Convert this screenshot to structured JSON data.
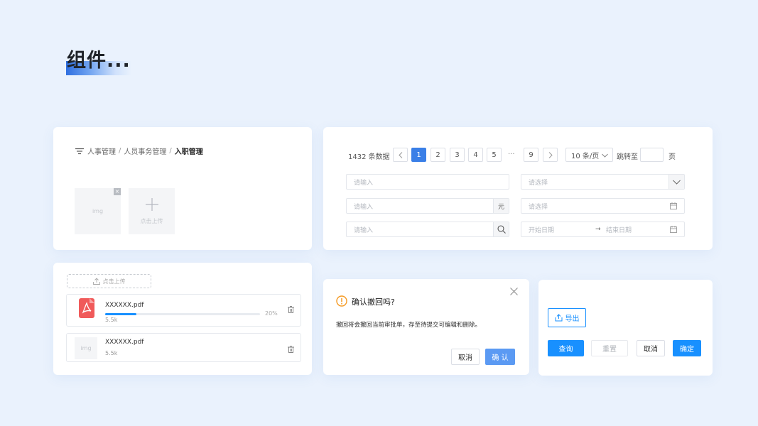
{
  "page": {
    "title": "组件..."
  },
  "breadcrumb": {
    "items": [
      "人事管理",
      "人员事务管理"
    ],
    "current": "入职管理",
    "separator": "/"
  },
  "image_upload": {
    "thumb_label": "img",
    "remove_glyph": "×",
    "add_label": "点击上传"
  },
  "pagination": {
    "total_text": "1432 条数据",
    "pages": [
      "1",
      "2",
      "3",
      "4",
      "5"
    ],
    "active_page": "1",
    "ellipsis": "···",
    "last_page": "9",
    "page_size": "10 条/页",
    "jump_label": "跳转至",
    "page_unit": "页"
  },
  "form": {
    "input1_placeholder": "请输入",
    "select1_placeholder": "请选择",
    "input2_placeholder": "请输入",
    "input2_suffix": "元",
    "date1_placeholder": "请选择",
    "input3_placeholder": "请输入",
    "range_start": "开始日期",
    "range_arrow": "→",
    "range_end": "结束日期"
  },
  "file_upload": {
    "button_label": "点击上传",
    "files": [
      {
        "name": "XXXXXX.pdf",
        "size": "5.5k",
        "progress": "20%",
        "progress_value": 0.2
      },
      {
        "name": "XXXXXX.pdf",
        "size": "5.5k",
        "thumb_label": "img"
      }
    ]
  },
  "dialog": {
    "title": "确认撤回吗?",
    "body": "撤回将会撤回当前审批单，存至待提交可编辑和删除。",
    "cancel": "取消",
    "confirm": "确 认"
  },
  "buttons": {
    "export": "导出",
    "query": "查询",
    "reset": "重置",
    "cancel": "取消",
    "ok": "确定"
  },
  "colors": {
    "primary": "#1890ff",
    "active_page": "#3a7fe7",
    "warning": "#f59a23",
    "pdf": "#f05a5a"
  }
}
